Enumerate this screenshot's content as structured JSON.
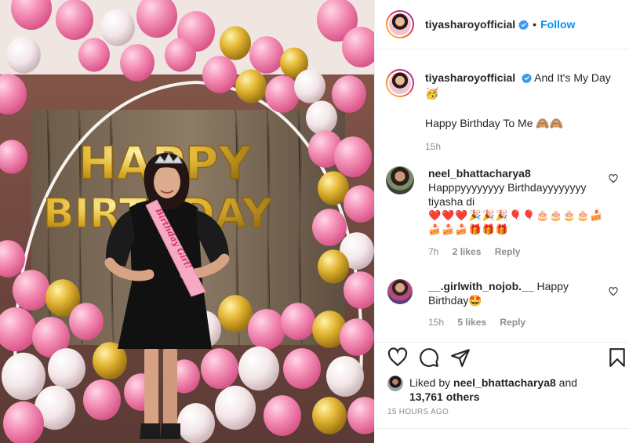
{
  "post": {
    "username": "tiyasharoyofficial",
    "follow_label": "Follow",
    "dot": "•",
    "caption_line1": "And It's My Day",
    "caption_emoji1": "🥳",
    "caption_line2": "Happy Birthday To Me 🙈🙈",
    "caption_time": "15h"
  },
  "photo": {
    "balloon_text_top": "HAPPY",
    "balloon_text_bottom": "BIRTHDAY",
    "sash_text": "Birthday Girl!"
  },
  "comments": [
    {
      "username": "neel_bhattacharya8",
      "text": "Happpyyyyyyyy Birthdayyyyyyyy tiyasha di",
      "emojis": "❤️❤️❤️🎉🎉🎉🎈🎈🎂🎂🎂🎂🍰🍰🍰🍰🎁🎁🎁",
      "time": "7h",
      "likes": "2 likes",
      "reply": "Reply"
    },
    {
      "username": "__.girlwith_nojob.__",
      "text": "Happy Birthday🤩",
      "time": "15h",
      "likes": "5 likes",
      "reply": "Reply"
    }
  ],
  "likes": {
    "prefix": "Liked by",
    "user": "neel_bhattacharya8",
    "and": "and",
    "count": "13,761 others"
  },
  "time_ago": "15 HOURS AGO",
  "icons": [
    "heart-icon",
    "comment-icon",
    "share-icon",
    "bookmark-icon",
    "verified-badge-icon"
  ],
  "colors": {
    "link": "#0095f6",
    "verified": "#3897f0",
    "meta": "#8e8e8e",
    "text": "#262626"
  }
}
